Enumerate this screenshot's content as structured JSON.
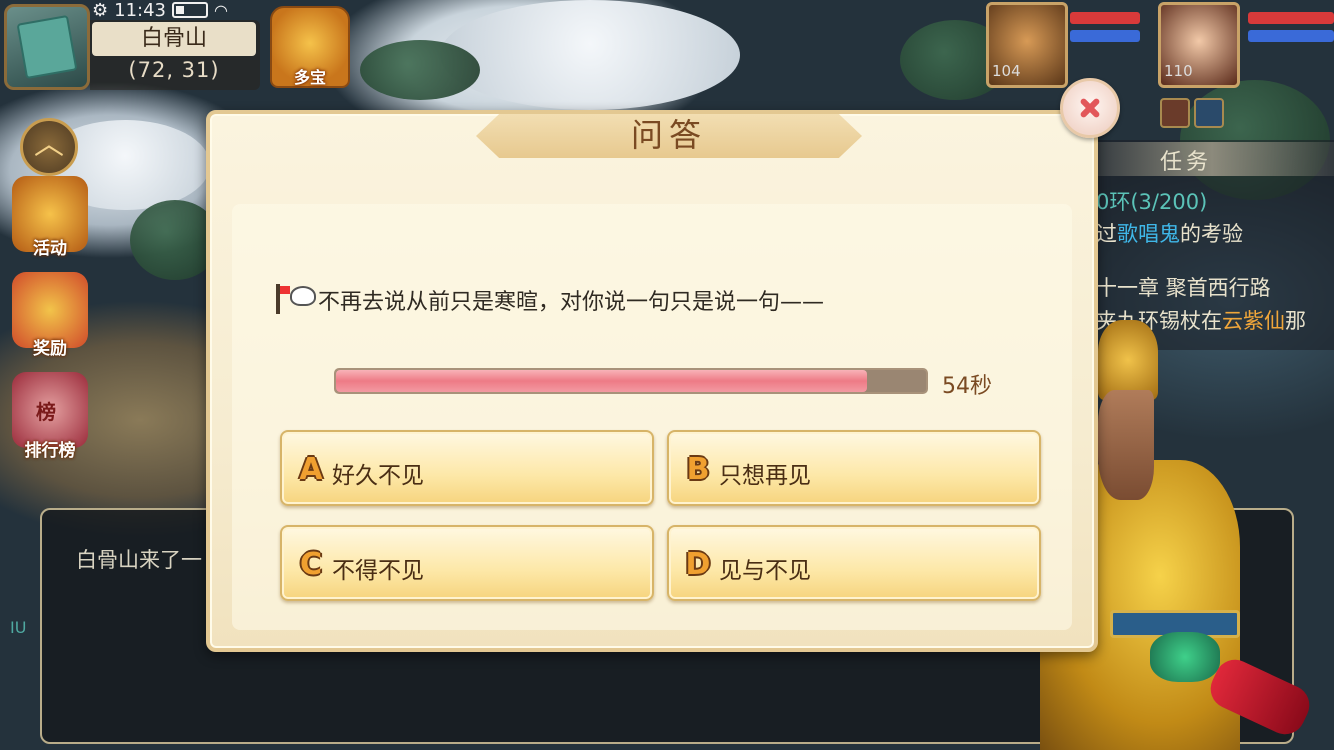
{
  "status": {
    "time": "11:43"
  },
  "location": {
    "name": "白骨山",
    "coords": "(72, 31)"
  },
  "top_buttons": {
    "duobao_label": "多宝"
  },
  "side_menu": [
    {
      "icon": "horn-icon",
      "label": "活动"
    },
    {
      "icon": "gift-icon",
      "label": "奖励"
    },
    {
      "icon": "ranking-icon",
      "label": "排行榜",
      "badge": "榜"
    }
  ],
  "party": [
    {
      "icon": "monkey-king-portrait",
      "level": "104"
    },
    {
      "icon": "hero-portrait",
      "level": "110"
    }
  ],
  "task_panel": {
    "title": "任务",
    "lines": [
      {
        "text": "0环(3/200)",
        "color": "#5bc3b8"
      },
      {
        "prefix": "过",
        "highlight": "歌唱鬼",
        "suffix": "的考验",
        "highlight_color": "#3fb7e8"
      },
      {
        "text": "十一章  聚首西行路"
      },
      {
        "prefix": "夹九环锡杖在",
        "highlight": "云紫仙",
        "suffix": "那",
        "highlight_color": "#f0a63a"
      }
    ]
  },
  "chat": {
    "text": "白骨山来了一",
    "side_text": "IU"
  },
  "dialog": {
    "title": "问答",
    "question": "不再去说从前只是寒暄，对你说一句只是说一句——",
    "timer": {
      "remaining_text": "54秒",
      "fill_fraction": 0.9
    },
    "options": [
      {
        "letter": "A",
        "text": "好久不见"
      },
      {
        "letter": "B",
        "text": "只想再见"
      },
      {
        "letter": "C",
        "text": "不得不见"
      },
      {
        "letter": "D",
        "text": "见与不见"
      }
    ]
  },
  "colors": {
    "dialog_bg": "#f6ecd0",
    "timer_fill": "#ee7b86",
    "option_bg": "#fde8a8",
    "close_x": "#e2575a"
  }
}
